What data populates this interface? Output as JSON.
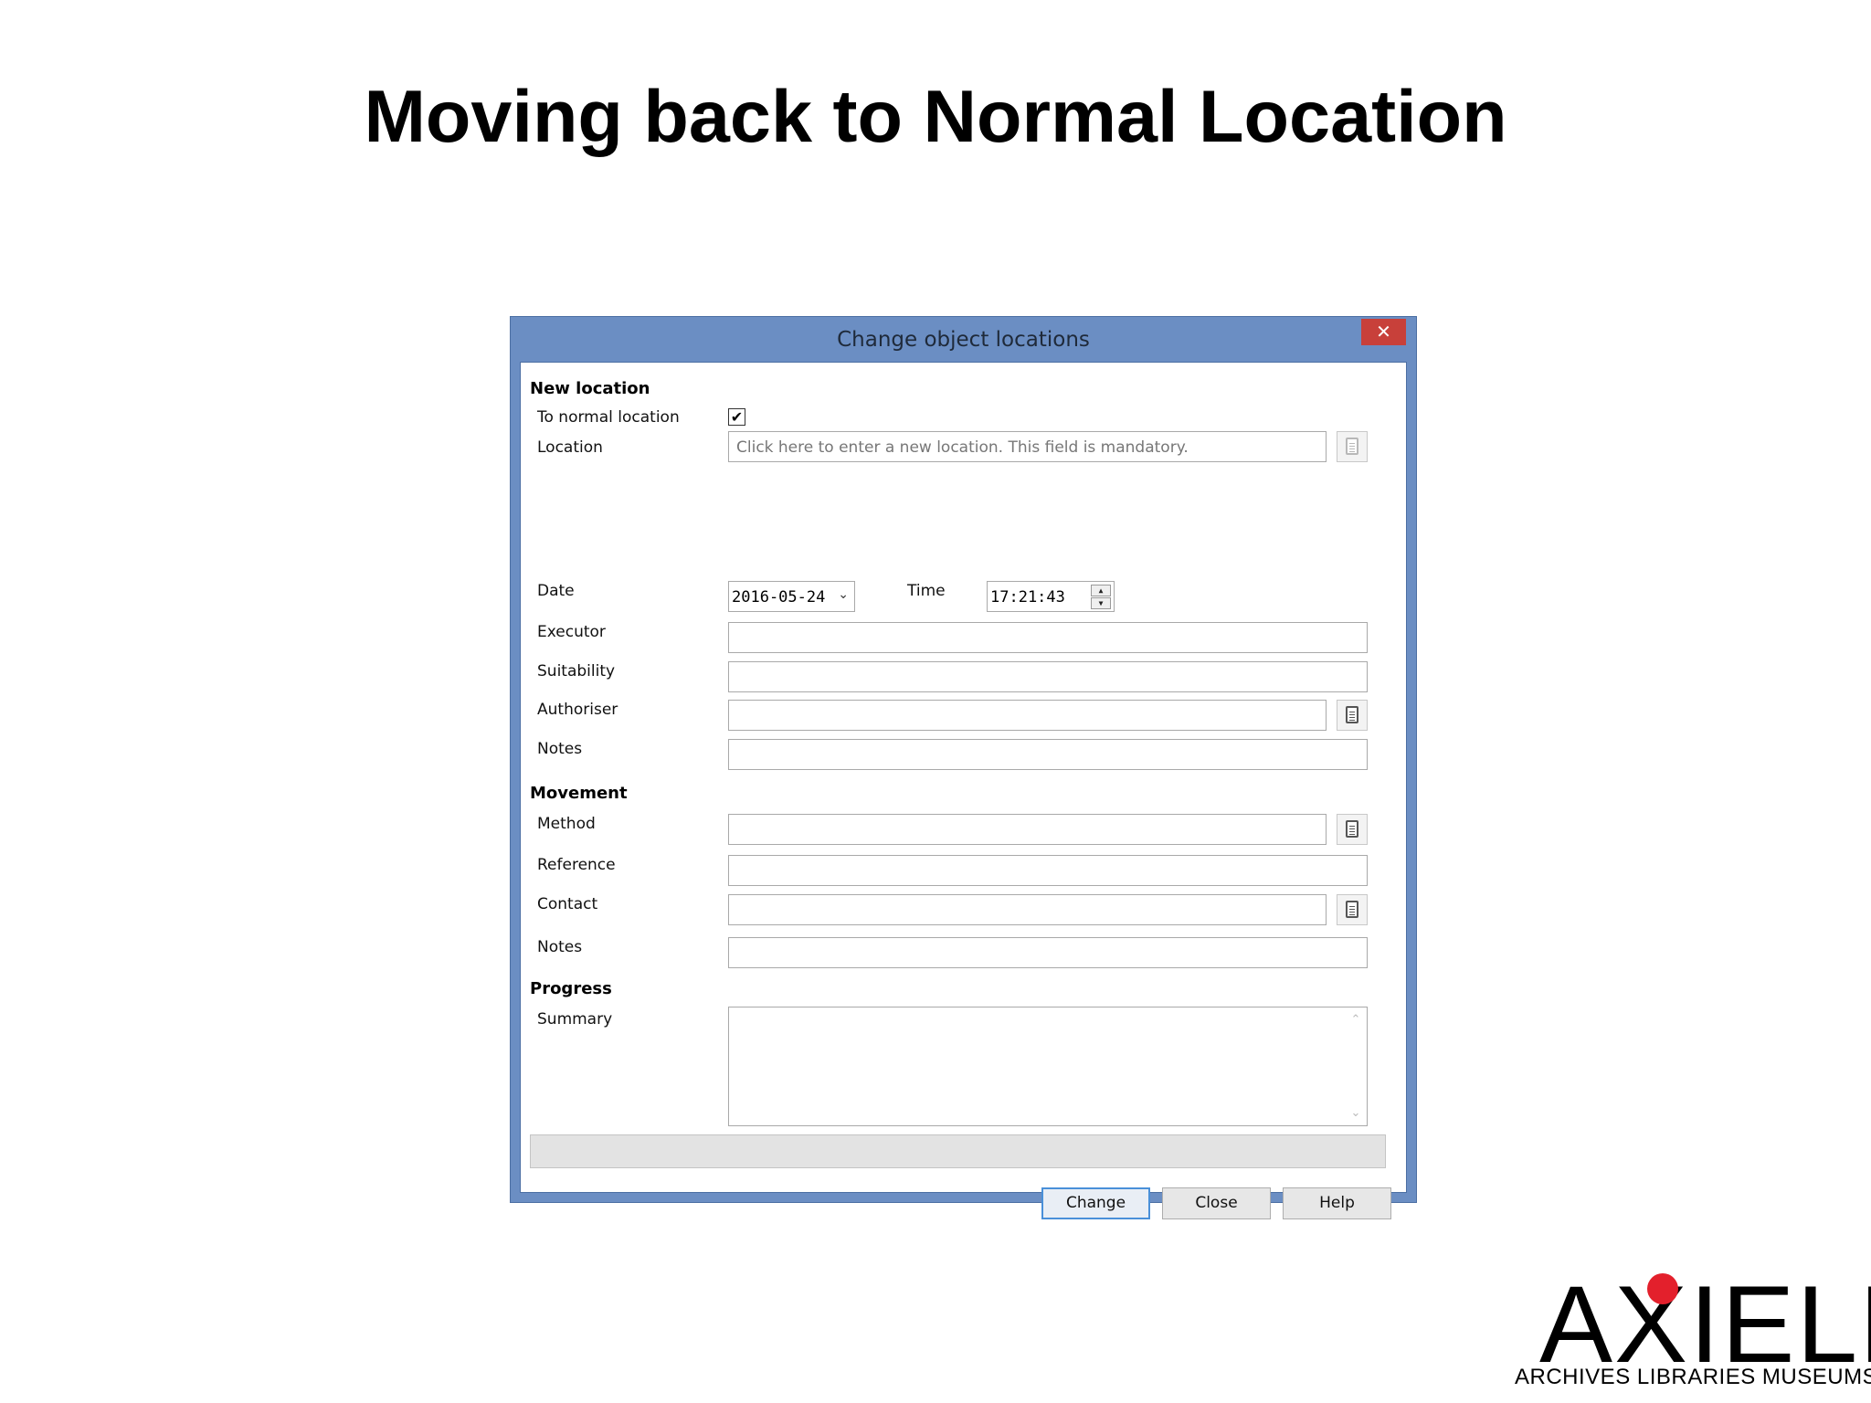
{
  "slide": {
    "title": "Moving back to Normal Location"
  },
  "dialog": {
    "title": "Change object locations",
    "close_glyph": "✕",
    "sections": {
      "new_location": "New location",
      "movement": "Movement",
      "progress": "Progress"
    },
    "new_location": {
      "to_normal_location_label": "To normal location",
      "to_normal_location_checked": true,
      "checkmark": "✔",
      "location_label": "Location",
      "location_placeholder": "Click here to enter a new location. This field is mandatory.",
      "date_label": "Date",
      "date_value": "2016-05-24",
      "time_label": "Time",
      "time_value": "17:21:43",
      "executor_label": "Executor",
      "executor_value": "",
      "suitability_label": "Suitability",
      "suitability_value": "",
      "authoriser_label": "Authoriser",
      "authoriser_value": "",
      "notes_label": "Notes",
      "notes_value": ""
    },
    "movement": {
      "method_label": "Method",
      "method_value": "",
      "reference_label": "Reference",
      "reference_value": "",
      "contact_label": "Contact",
      "contact_value": "",
      "notes_label": "Notes",
      "notes_value": ""
    },
    "progress": {
      "summary_label": "Summary",
      "summary_value": ""
    },
    "buttons": {
      "change": "Change",
      "close": "Close",
      "help": "Help"
    },
    "icons": {
      "close": "close-icon",
      "lookup": "lookup-list-icon",
      "dropdown": "chevron-down-icon",
      "spinner_up": "spin-up-icon",
      "spinner_down": "spin-down-icon"
    },
    "spin_up_glyph": "▲",
    "spin_down_glyph": "▼",
    "dropdown_glyph": "⌄",
    "scroll_up_glyph": "⌃",
    "scroll_down_glyph": "⌄"
  },
  "logo": {
    "wordmark": "AXIELL",
    "tagline": "ARCHIVES LIBRARIES MUSEUMS",
    "dot_color": "#e3202c"
  },
  "colors": {
    "dialog_frame": "#6b8ec3",
    "close_button": "#c8403a",
    "default_button_border": "#4a90d9"
  }
}
